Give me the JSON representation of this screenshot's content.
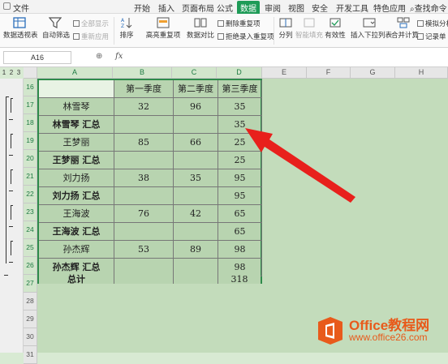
{
  "menubar": {
    "file_label": "文件",
    "tabs": [
      "开始",
      "插入",
      "页面布局",
      "公式",
      "数据",
      "审阅",
      "视图",
      "安全",
      "开发工具",
      "特色应用"
    ],
    "active_tab": "数据",
    "search_label": "查找命令"
  },
  "ribbon": {
    "pivot_table": "数据透视表",
    "auto_filter": "自动筛选",
    "show_all": "全部显示",
    "reapply": "重新应用",
    "sort": "排序",
    "highlight_dup": "高亮重复项",
    "data_compare": "数据对比",
    "remove_dup": "删除重复项",
    "reject_dup": "拒绝录入重复项",
    "split": "分列",
    "smart_fill": "智能填充",
    "validity": "有效性",
    "insert_dropdown": "插入下拉列表",
    "consolidate": "合并计算",
    "simulate": "模拟分析",
    "record_sheet": "记录单"
  },
  "formula_bar": {
    "cell_ref": "A16",
    "fx_label": "fx",
    "formula": ""
  },
  "outline_levels": [
    "1",
    "2",
    "3"
  ],
  "columns": [
    "A",
    "B",
    "C",
    "D",
    "E",
    "F",
    "G",
    "H"
  ],
  "rows": [
    "16",
    "17",
    "18",
    "19",
    "20",
    "21",
    "22",
    "23",
    "24",
    "25",
    "26",
    "27",
    "28",
    "29",
    "30",
    "31"
  ],
  "table": {
    "headers": [
      "",
      "第一季度",
      "第二季度",
      "第三季度"
    ],
    "rows": [
      {
        "name": "林雪琴",
        "q1": "32",
        "q2": "96",
        "q3": "35",
        "bold": false
      },
      {
        "name": "林雪琴 汇总",
        "q1": "",
        "q2": "",
        "q3": "35",
        "bold": true
      },
      {
        "name": "王梦丽",
        "q1": "85",
        "q2": "66",
        "q3": "25",
        "bold": false
      },
      {
        "name": "王梦丽 汇总",
        "q1": "",
        "q2": "",
        "q3": "25",
        "bold": true
      },
      {
        "name": "刘力扬",
        "q1": "38",
        "q2": "35",
        "q3": "95",
        "bold": false
      },
      {
        "name": "刘力扬 汇总",
        "q1": "",
        "q2": "",
        "q3": "95",
        "bold": true
      },
      {
        "name": "王海波",
        "q1": "76",
        "q2": "42",
        "q3": "65",
        "bold": false
      },
      {
        "name": "王海波 汇总",
        "q1": "",
        "q2": "",
        "q3": "65",
        "bold": true
      },
      {
        "name": "孙杰辉",
        "q1": "53",
        "q2": "89",
        "q3": "98",
        "bold": false
      },
      {
        "name": "孙杰辉 汇总",
        "q1": "",
        "q2": "",
        "q3": "98",
        "bold": true
      },
      {
        "name": "总计",
        "q1": "",
        "q2": "",
        "q3": "318",
        "bold": true
      }
    ]
  },
  "watermark": {
    "brand": "Office教程网",
    "url": "www.office26.com"
  },
  "colors": {
    "accent": "#1e9b57",
    "grid_bg": "#d5e9cf",
    "table_bg": "#b8d4b0",
    "arrow": "#e8201c",
    "logo": "#e85a1b"
  }
}
